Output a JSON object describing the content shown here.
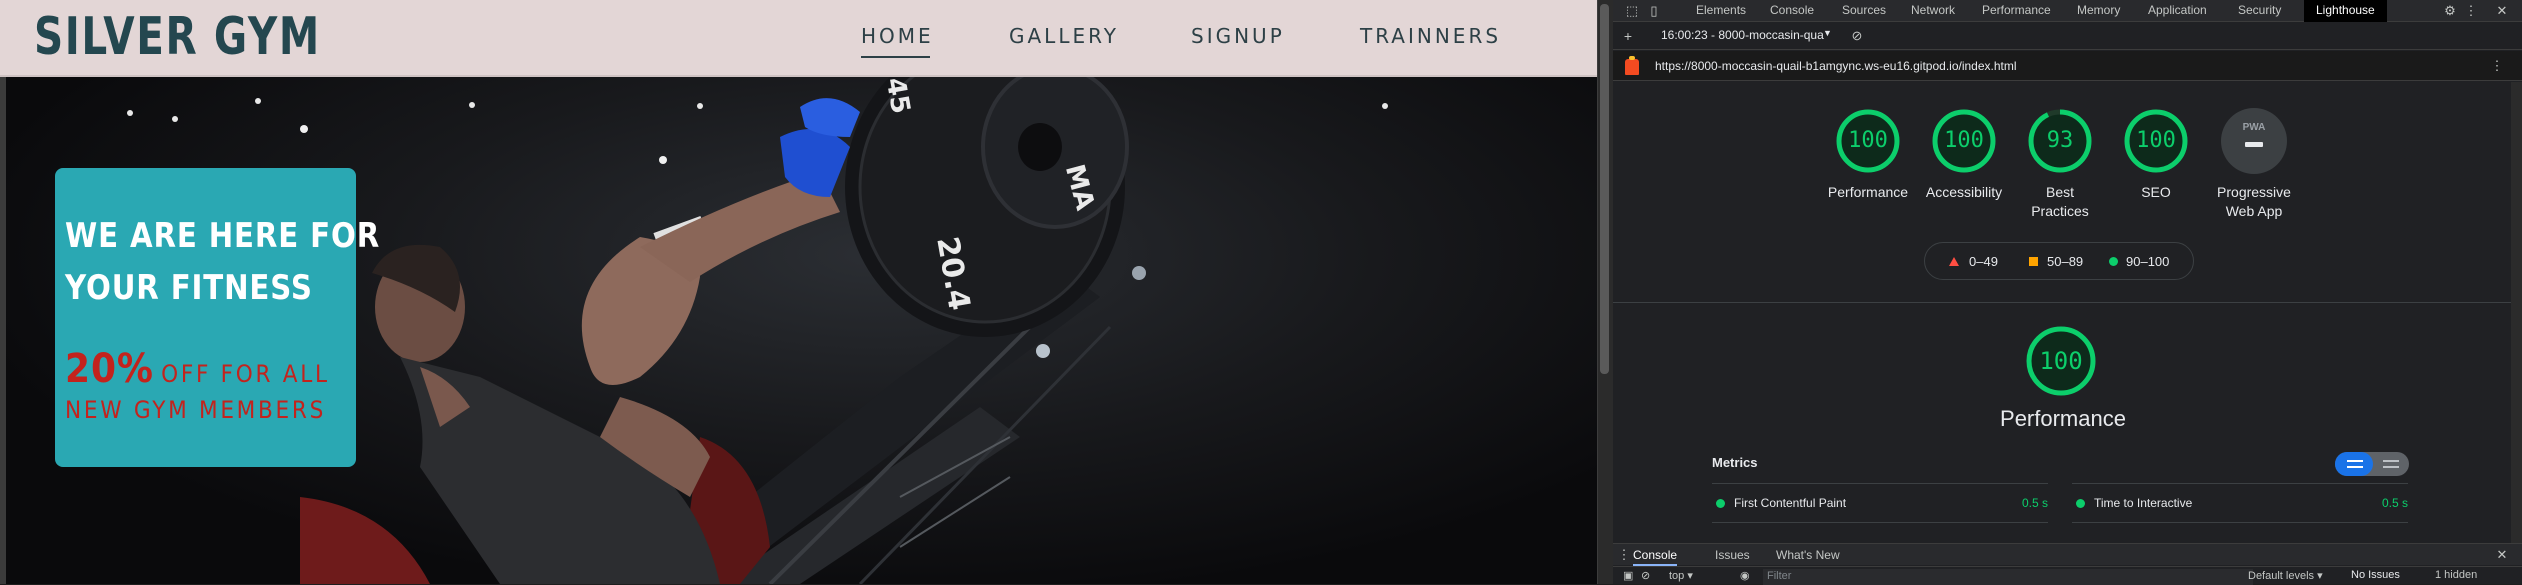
{
  "website": {
    "logo": "SILVER GYM",
    "nav": [
      {
        "label": "HOME",
        "active": true
      },
      {
        "label": "GALLERY",
        "active": false
      },
      {
        "label": "SIGNUP",
        "active": false
      },
      {
        "label": "TRAINNERS",
        "active": false
      }
    ],
    "banner": {
      "line1": "WE ARE HERE FOR",
      "line2": "YOUR FITNESS",
      "offer_percent": "20%",
      "offer_rest": "OFF FOR ALL",
      "offer_line2": "NEW GYM MEMBERS"
    }
  },
  "devtools": {
    "tabs": [
      "Elements",
      "Console",
      "Sources",
      "Network",
      "Performance",
      "Memory",
      "Application",
      "Security",
      "Lighthouse"
    ],
    "active_tab": "Lighthouse",
    "report_selector": "16:00:23 - 8000-moccasin-qua",
    "url": "https://8000-moccasin-quail-b1amgync.ws-eu16.gitpod.io/index.html",
    "scores": [
      {
        "label": "Performance",
        "value": "100"
      },
      {
        "label": "Accessibility",
        "value": "100"
      },
      {
        "label": "Best Practices",
        "label_line1": "Best",
        "label_line2": "Practices",
        "value": "93"
      },
      {
        "label": "SEO",
        "value": "100"
      }
    ],
    "pwa": {
      "label_line1": "Progressive",
      "label_line2": "Web App",
      "badge_text": "PWA"
    },
    "legend": [
      {
        "range": "0–49",
        "color": "#ff4e42"
      },
      {
        "range": "50–89",
        "color": "#ffa400"
      },
      {
        "range": "90–100",
        "color": "#0cce6b"
      }
    ],
    "performance": {
      "score": "100",
      "title": "Performance"
    },
    "metrics_label": "Metrics",
    "metrics": [
      {
        "name": "First Contentful Paint",
        "value": "0.5 s"
      },
      {
        "name": "Time to Interactive",
        "value": "0.5 s"
      }
    ],
    "drawer_tabs": [
      "Console",
      "Issues",
      "What's New"
    ],
    "drawer_active": "Console",
    "console_toolbar": {
      "context": "top ▾",
      "filter_placeholder": "Filter",
      "levels": "Default levels ▾",
      "issues": "No Issues",
      "hidden": "1 hidden"
    },
    "accent_green": "#0cce6b",
    "accent_orange": "#ffa400",
    "accent_red": "#ff4e42"
  }
}
